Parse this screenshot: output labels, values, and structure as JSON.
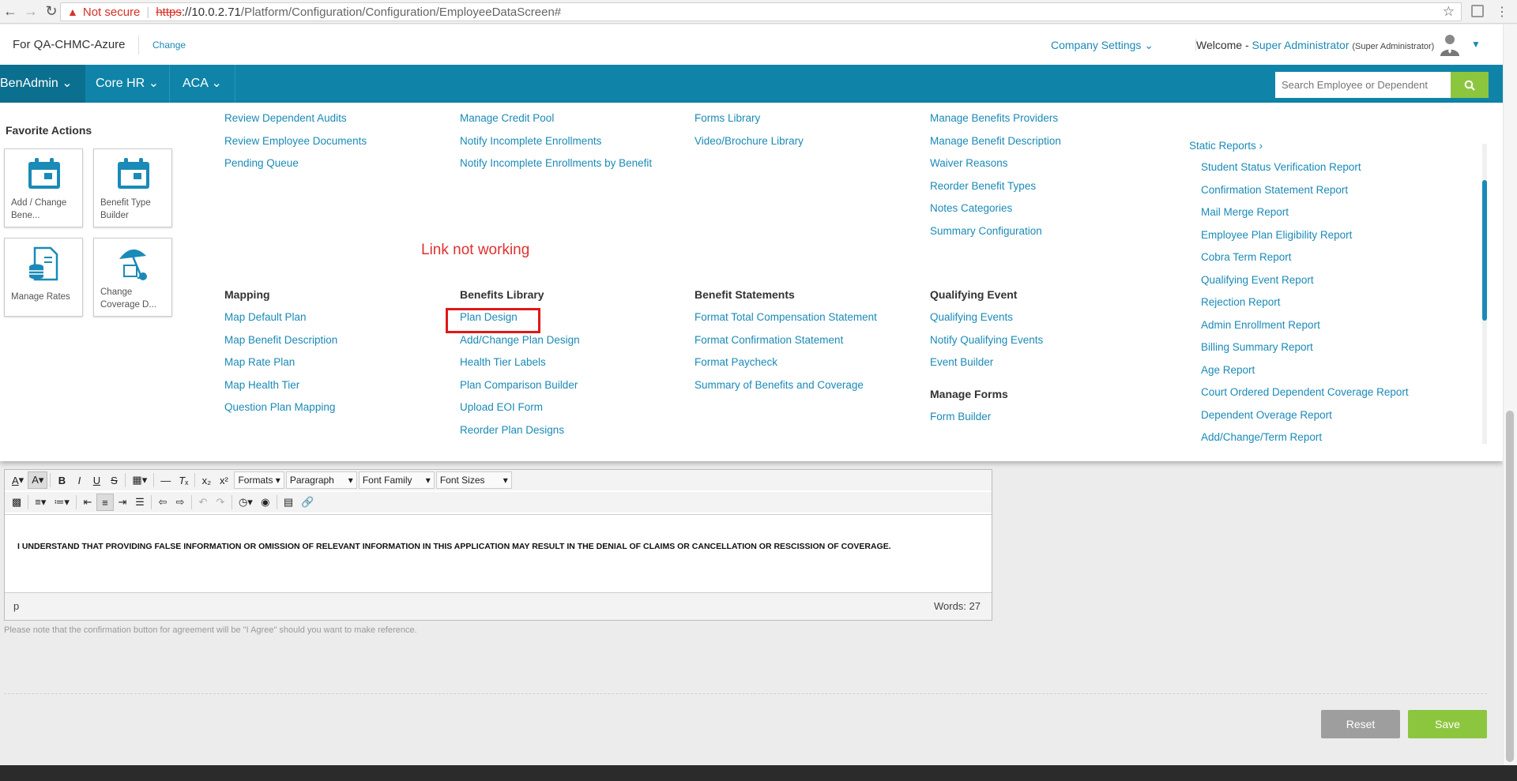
{
  "browser": {
    "security": "Not secure",
    "url_scheme": "https",
    "url_host": "://10.0.2.71",
    "url_path": "/Platform/Configuration/Configuration/EmployeeDataScreen#"
  },
  "header": {
    "client": "For QA-CHMC-Azure",
    "change": "Change",
    "company_settings": "Company Settings",
    "welcome": "Welcome -",
    "user": "Super Administrator",
    "role": "(Super Administrator)"
  },
  "nav": {
    "items": [
      "BenAdmin",
      "Core HR",
      "ACA"
    ],
    "search_placeholder": "Search Employee or Dependent"
  },
  "favorites": {
    "title": "Favorite Actions",
    "tiles": [
      "Add / Change Bene...",
      "Benefit Type Builder",
      "Manage Rates",
      "Change Coverage D..."
    ]
  },
  "menu": {
    "col1_top": [
      "Review Dependent Audits",
      "Review Employee Documents",
      "Pending Queue"
    ],
    "col1_head": "Mapping",
    "col1": [
      "Map Default Plan",
      "Map Benefit Description",
      "Map Rate Plan",
      "Map Health Tier",
      "Question Plan Mapping"
    ],
    "col2_top": [
      "Manage Credit Pool",
      "Notify Incomplete Enrollments",
      "Notify Incomplete Enrollments by Benefit"
    ],
    "col2_head": "Benefits Library",
    "col2": [
      "Plan Design",
      "Add/Change Plan Design",
      "Health Tier Labels",
      "Plan Comparison Builder",
      "Upload EOI Form",
      "Reorder Plan Designs"
    ],
    "col3_top": [
      "Forms Library",
      "Video/Brochure Library"
    ],
    "col3_head": "Benefit Statements",
    "col3": [
      "Format Total Compensation Statement",
      "Format Confirmation Statement",
      "Format Paycheck",
      "Summary of Benefits and Coverage"
    ],
    "col4_top": [
      "Manage Benefits Providers",
      "Manage Benefit Description",
      "Waiver Reasons",
      "Reorder Benefit Types",
      "Notes Categories",
      "Summary Configuration"
    ],
    "col4_head": "Qualifying Event",
    "col4": [
      "Qualifying Events",
      "Notify Qualifying Events",
      "Event Builder"
    ],
    "col4_head2": "Manage Forms",
    "col4b": [
      "Form Builder"
    ],
    "col5_head": "Static Reports",
    "col5": [
      "Student Status Verification Report",
      "Confirmation Statement Report",
      "Mail Merge Report",
      "Employee Plan Eligibility Report",
      "Cobra Term Report",
      "Qualifying Event Report",
      "Rejection Report",
      "Admin Enrollment Report",
      "Billing Summary Report",
      "Age Report",
      "Court Ordered Dependent Coverage Report",
      "Dependent Overage Report",
      "Add/Change/Term Report"
    ],
    "annotation": "Link not working"
  },
  "editor": {
    "formats": "Formats",
    "paragraph": "Paragraph",
    "font_family": "Font Family",
    "font_sizes": "Font Sizes",
    "content": "I UNDERSTAND THAT PROVIDING FALSE INFORMATION OR OMISSION OF RELEVANT INFORMATION IN THIS APPLICATION MAY RESULT IN THE DENIAL OF CLAIMS OR CANCELLATION OR RESCISSION OF COVERAGE.",
    "path": "p",
    "words": "Words: 27"
  },
  "hint": "Please note that the confirmation button for agreement will be \"I Agree\" should you want to make reference.",
  "buttons": {
    "reset": "Reset",
    "save": "Save"
  },
  "colors": {
    "nav": "#0f84a8",
    "link": "#1a8ab7",
    "green": "#8cc63f",
    "annotation": "#e03030"
  }
}
